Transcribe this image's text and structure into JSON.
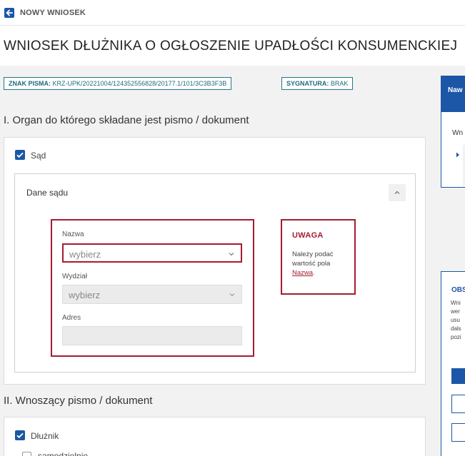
{
  "header": {
    "back_label": "NOWY WNIOSEK",
    "page_title": "WNIOSEK DŁUŻNIKA O OGŁOSZENIE UPADŁOŚCI KONSUMENCKIEJ"
  },
  "tags": {
    "znak_label": "ZNAK PISMA:",
    "znak_value": "KRZ-UPK/20221004/124352556828/20177.1/101/3C3B3F3B",
    "sygnatura_label": "SYGNATURA:",
    "sygnatura_value": "BRAK"
  },
  "section1": {
    "heading": "I. Organ do którego składane jest pismo / dokument",
    "checkbox_label": "Sąd",
    "panel_title": "Dane sądu",
    "fields": {
      "nazwa_label": "Nazwa",
      "nazwa_value": "wybierz",
      "wydzial_label": "Wydział",
      "wydzial_value": "wybierz",
      "adres_label": "Adres",
      "adres_value": ""
    },
    "warning": {
      "title": "UWAGA",
      "text": "Należy podać wartość pola",
      "link": "Nazwa",
      "suffix": "."
    }
  },
  "section2": {
    "heading": "II. Wnoszący pismo / dokument",
    "checkbox_label": "Dłużnik",
    "sub_checkbox_label": "samodzielnie"
  },
  "sidebar": {
    "nav_title": "Naw",
    "nav_sub": "Wn",
    "obs_title": "OBS",
    "obs_lines": [
      "Wni",
      "wer",
      "usu",
      "dals",
      "pozi"
    ]
  },
  "colors": {
    "primary": "#1b57a6",
    "error": "#a51c30",
    "tag": "#1f7a8c"
  }
}
